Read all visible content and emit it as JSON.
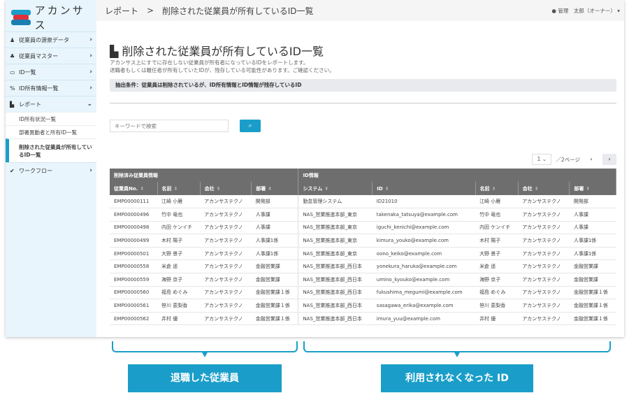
{
  "app": {
    "logo_text": "アカンサス",
    "brand_color": "#1a9ec9"
  },
  "header": {
    "breadcrumb_parent": "レポート",
    "breadcrumb_sep": ">",
    "breadcrumb_current": "削除された従業員が所有しているID一覧",
    "user": "管理　太郎（オーナー）"
  },
  "sidebar": {
    "items": [
      {
        "icon": "user-icon",
        "glyph": "♟",
        "label": "従業員の源泉データ",
        "chevron": "›"
      },
      {
        "icon": "users-icon",
        "glyph": "♣",
        "label": "従業員マスター",
        "chevron": "›"
      },
      {
        "icon": "id-card-icon",
        "glyph": "▭",
        "label": "ID一覧",
        "chevron": "›"
      },
      {
        "icon": "link-icon",
        "glyph": "%",
        "label": "ID所有情報一覧",
        "chevron": "›"
      },
      {
        "icon": "file-icon",
        "glyph": "▙",
        "label": "レポート",
        "chevron": "⌄"
      }
    ],
    "subitems": [
      "ID所有状況一覧",
      "部署異動者と所有ID一覧",
      "削除された従業員が所有しているID一覧"
    ],
    "workflow": {
      "icon": "check-icon",
      "glyph": "✔",
      "label": "ワークフロー",
      "chevron": "›"
    }
  },
  "main": {
    "title": "削除された従業員が所有しているID一覧",
    "desc1": "アカンサス上にすでに存在しない従業員が所有者になっているIDをレポートします。",
    "desc2": "退職者もしくは離任者が所有していたIDが、残存している可能性があります。ご確認ください。",
    "condition": "抽出条件：従業員は削除されているが、ID所有情報とID情報が残存しているID",
    "search_placeholder": "キーワードで検索",
    "page_value": "1",
    "page_total": "／2ページ"
  },
  "table": {
    "groups": [
      "削除済み従業員情報",
      "ID情報"
    ],
    "columns": [
      "従業員No.",
      "名前",
      "会社",
      "部署",
      "システム",
      "ID",
      "名前",
      "会社",
      "部署"
    ],
    "rows": [
      [
        "EMP00000111",
        "江崎 小雁",
        "アカンサステクノ",
        "開発部",
        "勤怠管理システム",
        "ID21010",
        "江崎 小雁",
        "アカンサステクノ",
        "開発部"
      ],
      [
        "EMP00000496",
        "竹中 竜也",
        "アカンサステクノ",
        "人事課",
        "NAS_営業推進本部_東京",
        "takenaka_tatsuya@example.com",
        "竹中 竜也",
        "アカンサステクノ",
        "人事課"
      ],
      [
        "EMP00000498",
        "内田 ケンイチ",
        "アカンサステクノ",
        "人事課",
        "NAS_営業推進本部_東京",
        "iguchi_kenichi@example.com",
        "内田 ケンイチ",
        "アカンサステクノ",
        "人事課"
      ],
      [
        "EMP00000499",
        "木村 陽子",
        "アカンサステクノ",
        "人事課1係",
        "NAS_営業推進本部_東京",
        "kimura_youko@example.com",
        "木村 陽子",
        "アカンサステクノ",
        "人事課1係"
      ],
      [
        "EMP00000501",
        "大野 景子",
        "アカンサステクノ",
        "人事課1係",
        "NAS_営業推進本部_東京",
        "oono_keiko@example.com",
        "大野 景子",
        "アカンサステクノ",
        "人事課1係"
      ],
      [
        "EMP00000558",
        "米倉 遥",
        "アカンサステクノ",
        "金融営業課",
        "NAS_営業推進本部_西日本",
        "yonekura_haruka@example.com",
        "米倉 遥",
        "アカンサステクノ",
        "金融営業課"
      ],
      [
        "EMP00000559",
        "海野 京子",
        "アカンサステクノ",
        "金融営業課",
        "NAS_営業推進本部_西日本",
        "umino_kyouko@example.com",
        "海野 京子",
        "アカンサステクノ",
        "金融営業課"
      ],
      [
        "EMP00000560",
        "福島 めぐみ",
        "アカンサステクノ",
        "金融営業課１係",
        "NAS_営業推進本部_西日本",
        "fukushima_megumi@example.com",
        "福島 めぐみ",
        "アカンサステクノ",
        "金融営業課１係"
      ],
      [
        "EMP00000561",
        "笹川 恵梨香",
        "アカンサステクノ",
        "金融営業課１係",
        "NAS_営業推進本部_西日本",
        "sasagawa_erika@example.com",
        "笹川 恵梨香",
        "アカンサステクノ",
        "金融営業課１係"
      ],
      [
        "EMP00000562",
        "井村 優",
        "アカンサステクノ",
        "金融営業課１係",
        "NAS_営業推進本部_西日本",
        "imura_yuu@example.com",
        "井村 優",
        "アカンサステクノ",
        "金融営業課１係"
      ]
    ]
  },
  "callouts": [
    "退職した従業員",
    "利用されなくなった ID"
  ]
}
